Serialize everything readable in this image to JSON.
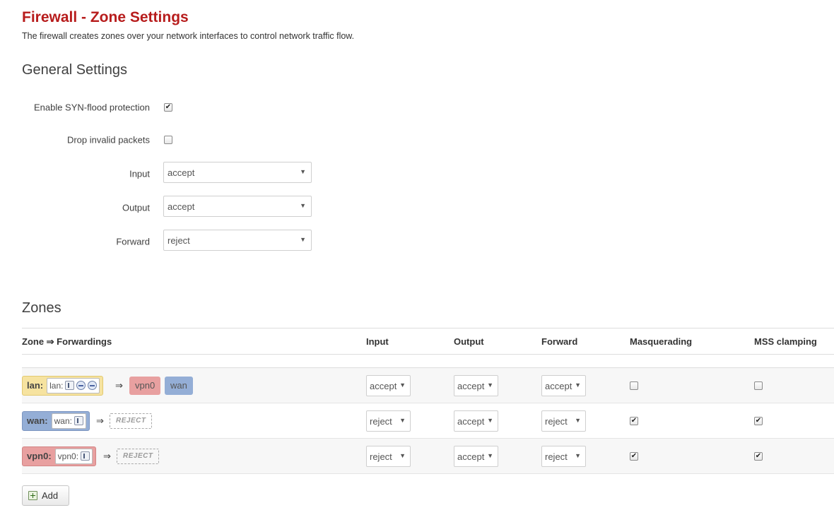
{
  "header": {
    "title": "Firewall - Zone Settings",
    "description": "The firewall creates zones over your network interfaces to control network traffic flow."
  },
  "general": {
    "section_title": "General Settings",
    "syn_flood": {
      "label": "Enable SYN-flood protection",
      "checked": true,
      "mark": "✔"
    },
    "drop_invalid": {
      "label": "Drop invalid packets",
      "checked": false,
      "mark": ""
    },
    "input": {
      "label": "Input",
      "value": "accept"
    },
    "output": {
      "label": "Output",
      "value": "accept"
    },
    "forward": {
      "label": "Forward",
      "value": "reject"
    }
  },
  "zones": {
    "section_title": "Zones",
    "columns": {
      "zone": "Zone ⇒ Forwardings",
      "input": "Input",
      "output": "Output",
      "forward": "Forward",
      "masquerading": "Masquerading",
      "mss": "MSS clamping"
    },
    "arrow": "⇒",
    "rows": [
      {
        "name": "lan:",
        "inner": "lan:",
        "color": "#f6e3a0",
        "forwards": [
          {
            "label": "vpn0",
            "color": "#e8a0a0"
          },
          {
            "label": "wan",
            "color": "#94aed6"
          }
        ],
        "input": "accept",
        "output": "accept",
        "forward": "accept",
        "masq": "",
        "mss": ""
      },
      {
        "name": "wan:",
        "inner": "wan:",
        "color": "#94aed6",
        "reject": "REJECT",
        "input": "reject",
        "output": "accept",
        "forward": "reject",
        "masq": "✔",
        "mss": "✔"
      },
      {
        "name": "vpn0:",
        "inner": "vpn0:",
        "color": "#e8a0a0",
        "reject": "REJECT",
        "input": "reject",
        "output": "accept",
        "forward": "reject",
        "masq": "✔",
        "mss": "✔"
      }
    ],
    "add_label": "Add"
  },
  "caret": "▼"
}
